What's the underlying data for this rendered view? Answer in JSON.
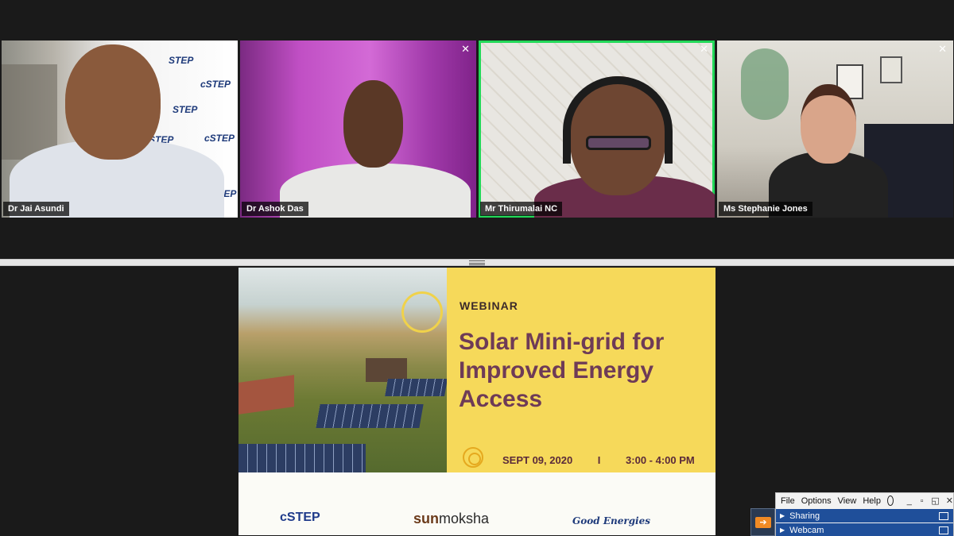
{
  "participants": [
    {
      "name": "Dr Jai Asundi",
      "closable": false,
      "speaking": false
    },
    {
      "name": "Dr Ashok Das",
      "closable": true,
      "speaking": false
    },
    {
      "name": "Mr Thirumalai NC",
      "closable": true,
      "speaking": true
    },
    {
      "name": "Ms Stephanie Jones",
      "closable": true,
      "speaking": false
    }
  ],
  "close_glyph": "✕",
  "backdrop_text": {
    "step": "STEP",
    "cstep": "cSTEP",
    "partial": "TEP"
  },
  "colors": {
    "speaking_outline": "#23d959",
    "slide_yellow": "#f6d95a",
    "title_color": "#6e3b57",
    "panel_blue": "#1f4f9a"
  },
  "slide": {
    "label": "WEBINAR",
    "title": "Solar Mini-grid for Improved Energy Access",
    "date": "SEPT 09, 2020",
    "separator": "I",
    "time": "3:00 - 4:00 PM",
    "logos": {
      "cstep": "cSTEP",
      "sun": "sun",
      "moksha": "moksha",
      "good": "Good Energies"
    }
  },
  "control_panel": {
    "menu": [
      "File",
      "Options",
      "View",
      "Help"
    ],
    "globe_icon": "globe-icon",
    "rows": [
      {
        "label": "Sharing"
      },
      {
        "label": "Webcam"
      }
    ],
    "tab_arrow": "➔"
  }
}
